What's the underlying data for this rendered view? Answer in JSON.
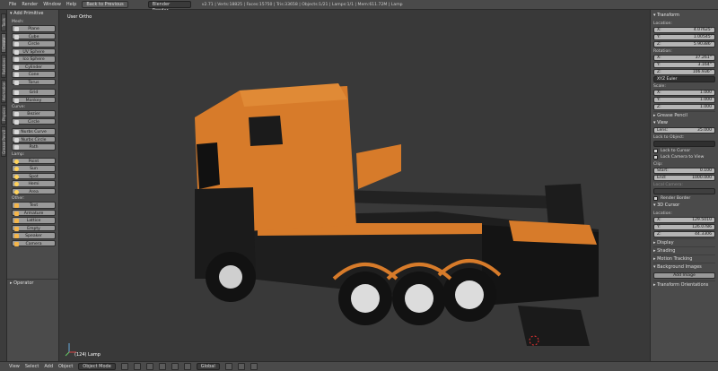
{
  "topbar": {
    "menus": [
      "File",
      "Render",
      "Window",
      "Help"
    ],
    "back_button": "Back to Previous",
    "render_engine": "Blender Render",
    "stats": "v2.71 | Verts:18825 | Faces:15750 | Tris:33658 | Objects:1/21 | Lamps:1/1 | Mem:611.72M | Lamp"
  },
  "vertical_tabs": [
    "Tools",
    "Create",
    "Relations",
    "Animation",
    "Physics",
    "Grease Pencil"
  ],
  "toolshelf": {
    "header": "Add Primitive",
    "groups": [
      {
        "label": "Mesh:",
        "buttons": [
          "Plane",
          "Cube",
          "Circle",
          "UV Sphere",
          "Ico Sphere",
          "Cylinder",
          "Cone",
          "Torus",
          "Grid",
          "Monkey"
        ]
      },
      {
        "label": "Curve:",
        "buttons": [
          "Bezier",
          "Circle",
          "Nurbs Curve",
          "Nurbs Circle",
          "Path"
        ]
      },
      {
        "label": "Lamp:",
        "buttons": [
          "Point",
          "Sun",
          "Spot",
          "Hemi",
          "Area"
        ]
      },
      {
        "label": "Other:",
        "buttons": [
          "Text",
          "Armature",
          "Lattice",
          "Empty",
          "Speaker",
          "Camera"
        ]
      }
    ],
    "operator": "Operator"
  },
  "viewport": {
    "view_label": "User Ortho",
    "object_label": "(124) Lamp"
  },
  "properties": {
    "transform_header": "Transform",
    "location_label": "Location:",
    "location": [
      {
        "axis": "X:",
        "value": "4.07625'"
      },
      {
        "axis": "Y:",
        "value": "1.00545'"
      },
      {
        "axis": "Z:",
        "value": "5.90386'"
      }
    ],
    "rotation_label": "Rotation:",
    "rotation": [
      {
        "axis": "X:",
        "value": "37.261°"
      },
      {
        "axis": "Y:",
        "value": "3.164°"
      },
      {
        "axis": "Z:",
        "value": "106.936°"
      }
    ],
    "rotation_mode": "XYZ Euler",
    "scale_label": "Scale:",
    "scale": [
      {
        "axis": "X:",
        "value": "1.000"
      },
      {
        "axis": "Y:",
        "value": "1.000"
      },
      {
        "axis": "Z:",
        "value": "1.000"
      }
    ],
    "grease_pencil": "Grease Pencil",
    "view_header": "View",
    "lens_label": "Lens:",
    "lens_value": "35.000",
    "lock_to_object": "Lock to Object:",
    "lock_to_cursor": "Lock to Cursor",
    "lock_camera": "Lock Camera to View",
    "clip_label": "Clip:",
    "clip_start_label": "Start:",
    "clip_start": "0.100",
    "clip_end_label": "End:",
    "clip_end": "1000.000",
    "local_camera": "Local Camera:",
    "render_border": "Render Border",
    "cursor_header": "3D Cursor",
    "cursor_location_label": "Location:",
    "cursor": [
      {
        "axis": "X:",
        "value": "129.5010"
      },
      {
        "axis": "Y:",
        "value": "126.0786"
      },
      {
        "axis": "Z:",
        "value": "44.3306"
      }
    ],
    "display": "Display",
    "shading": "Shading",
    "motion_tracking": "Motion Tracking",
    "background_images": "Background Images",
    "add_image": "Add Image",
    "transform_orientations": "Transform Orientations"
  },
  "bottombar": {
    "menus": [
      "View",
      "Select",
      "Add",
      "Object"
    ],
    "mode": "Object Mode",
    "orientation": "Global"
  },
  "colors": {
    "cab_orange": "#d77b2a",
    "body_black": "#1b1b1b",
    "viewport_bg": "#393939"
  }
}
